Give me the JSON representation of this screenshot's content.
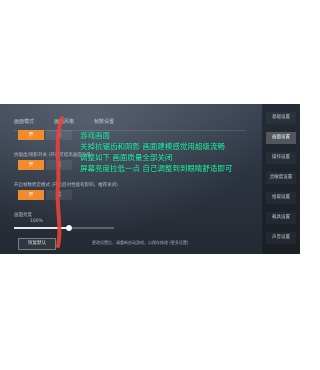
{
  "tabs": [
    "画面模式",
    "画面风格",
    "帧数设置"
  ],
  "options": {
    "seg_on": "开",
    "seg_off": "关",
    "row2_label": "抗锯齿/阴影开关 (开启可提高画面效果)",
    "row3_label": "开启帧数稳定模式 (开启后对性能有影响，推荐关闭)",
    "brightness_label": "画面亮度",
    "brightness_value": "100%"
  },
  "sidebar": {
    "items": [
      "基础设置",
      "画面设置",
      "操作设置",
      "灵敏度设置",
      "拾取设置",
      "载具设置",
      "声音设置"
    ]
  },
  "overlay_lines": [
    "游戏画面",
    "关掉抗锯齿和阴影 画面建模感觉用超级流畅",
    "调整如下 画面质量全部关闭",
    "屏幕亮度拉低一点 自己调整到到眼睛舒适即可"
  ],
  "bottom": {
    "button_label": "恢复默认",
    "note": "更改设置后，请重新启动游戏，以保存修改 (更多设置)"
  },
  "brightness_fraction": 0.55,
  "accent": "#f28b2c",
  "overlay_color": "#2cf0b0",
  "annotation_color": "#e8413a"
}
